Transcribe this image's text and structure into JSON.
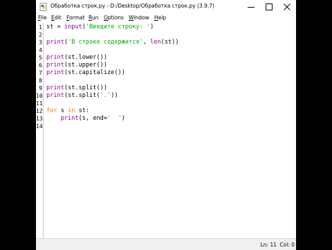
{
  "window": {
    "title": "Обработка строк.py - D:/Desktop/Обработка строк.py (3.9.7)"
  },
  "menu": [
    {
      "label": "File",
      "accel": "F",
      "rest": "ile"
    },
    {
      "label": "Edit",
      "accel": "E",
      "rest": "dit"
    },
    {
      "label": "Format",
      "accel": "F",
      "rest": "ormat"
    },
    {
      "label": "Run",
      "accel": "R",
      "rest": "un"
    },
    {
      "label": "Options",
      "accel": "O",
      "rest": "ptions"
    },
    {
      "label": "Window",
      "accel": "W",
      "rest": "indow"
    },
    {
      "label": "Help",
      "accel": "H",
      "rest": "elp"
    }
  ],
  "editor": {
    "line_numbers": [
      "1",
      "2",
      "3",
      "4",
      "5",
      "6",
      "7",
      "8",
      "9",
      "10",
      "11",
      "12",
      "13",
      "14"
    ],
    "lines": [
      "st = input('Введите строку: ')",
      "",
      "print('В строке содержится', len(st))",
      "",
      "print(st.lower())",
      "print(st.upper())",
      "print(st.capitalize())",
      "",
      "print(st.split())",
      "print(st.split('.'))",
      "",
      "for s in st:",
      "    print(s, end='  ')",
      ""
    ]
  },
  "status": {
    "line": "Ln: 11",
    "col": "Col: 0"
  },
  "colors": {
    "keyword": "#ff7700",
    "builtin": "#900090",
    "string": "#00aa00"
  }
}
